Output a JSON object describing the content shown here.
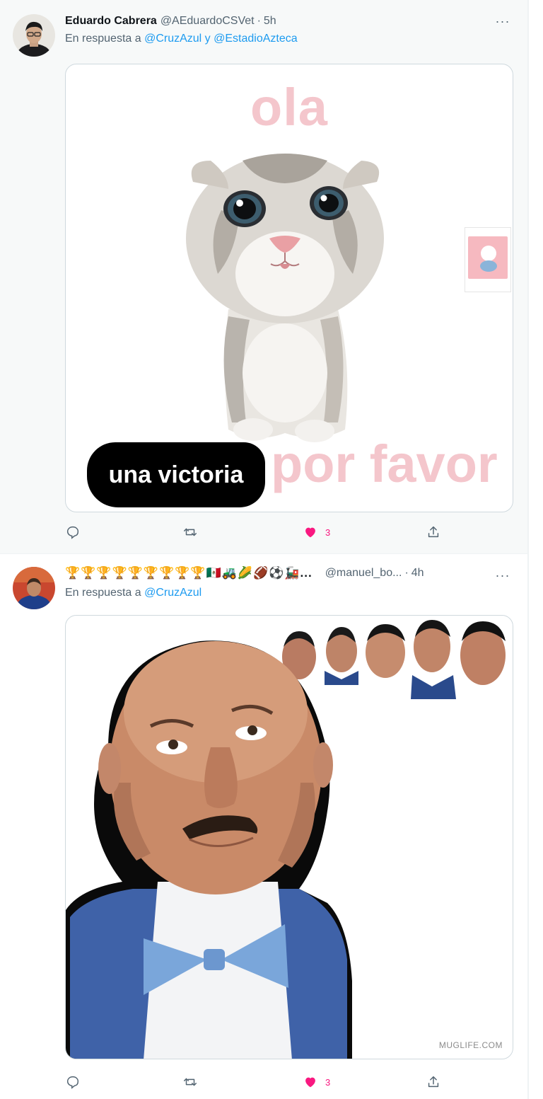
{
  "tweets": [
    {
      "display_name": "Eduardo Cabrera",
      "handle": "@AEduardoCSVet",
      "separator": "·",
      "time": "5h",
      "reply_prefix": "En respuesta a",
      "reply_to": "@CruzAzul y @EstadioAzteca",
      "more_label": "···",
      "media": {
        "top_text": "ola",
        "label_text": "una victoria",
        "bottom_text": "por favor"
      },
      "actions": {
        "replies": "",
        "retweets": "",
        "likes": "3",
        "liked": true
      }
    },
    {
      "display_name": "🏆🏆🏆🏆🏆🏆🏆🏆🏆🇲🇽🚜🌽🏈⚽🚂...",
      "handle": "@manuel_bo...",
      "separator": "·",
      "time": "4h",
      "reply_prefix": "En respuesta a",
      "reply_to": "@CruzAzul",
      "more_label": "···",
      "media": {
        "watermark": "MUGLIFE.COM"
      },
      "actions": {
        "replies": "",
        "retweets": "",
        "likes": "3",
        "liked": true
      }
    }
  ],
  "colors": {
    "link": "#1d9bf0",
    "like": "#f91880",
    "meme_pink": "#f4c6cc",
    "secondary_text": "#536471"
  },
  "icons": [
    "reply-icon",
    "retweet-icon",
    "heart-icon",
    "share-icon",
    "more-icon"
  ]
}
